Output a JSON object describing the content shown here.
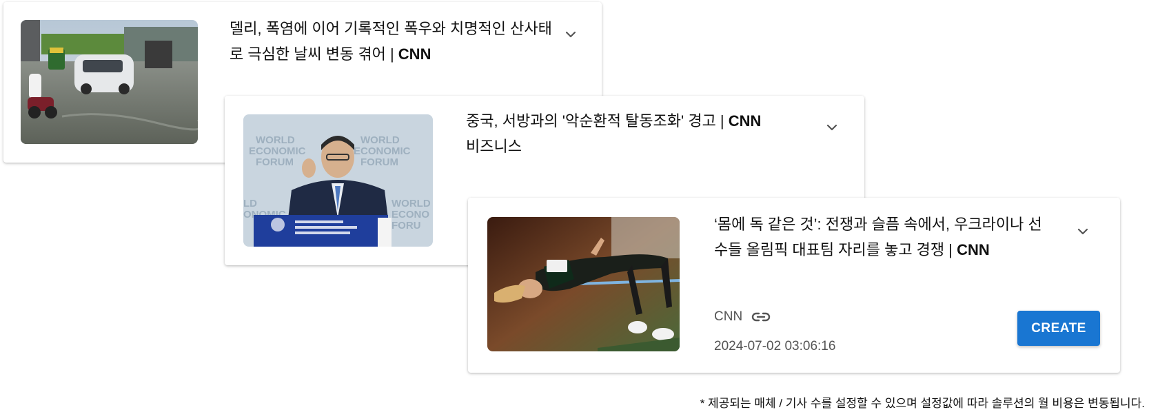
{
  "cards": [
    {
      "title": "델리, 폭염에 이어 기록적인 폭우와 치명적인 산사태로 극심한 날씨 변동 겪어 | ",
      "title_bold": "CNN",
      "title_tail": "",
      "image": "flooded-street-image"
    },
    {
      "title": "중국, 서방과의 '악순환적 탈동조화' 경고 | ",
      "title_bold": "CNN",
      "title_tail": " 비즈니스",
      "image": "speaker-at-podium-image"
    },
    {
      "title": "‘몸에 독 같은 것’: 전쟁과 슬픔 속에서, 우크라이나 선수들 올림픽 대표팀 자리를 놓고 경쟁 | ",
      "title_bold": "CNN",
      "title_tail": "",
      "image": "high-jump-athlete-image",
      "source": "CNN",
      "timestamp": "2024-07-02 03:06:16",
      "create_label": "CREATE"
    }
  ],
  "footnote": "* 제공되는 매체 / 기사 수를 설정할 수 있으며 설정값에 따라 솔루션의 월 비용은 변동됩니다.",
  "colors": {
    "accent": "#1976d2",
    "secondary_text": "#555555"
  },
  "icons": [
    "chevron-down-icon",
    "link-icon"
  ]
}
